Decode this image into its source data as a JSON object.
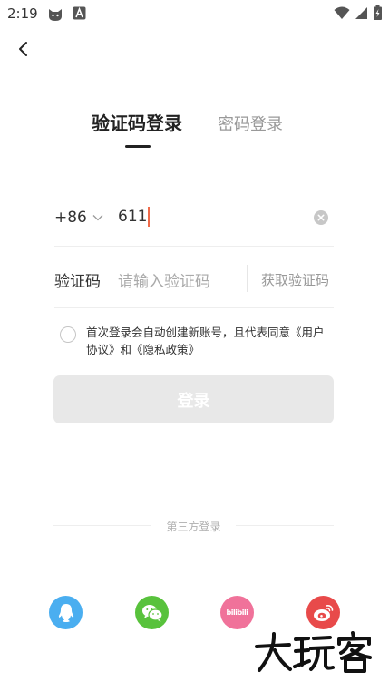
{
  "status_bar": {
    "time": "2:19",
    "icons": [
      "cat-app-icon",
      "a-app-icon",
      "wifi-icon",
      "signal-icon",
      "battery-icon"
    ]
  },
  "nav": {
    "back_icon": "chevron-left-icon"
  },
  "tabs": [
    {
      "label": "验证码登录",
      "active": true
    },
    {
      "label": "密码登录",
      "active": false
    }
  ],
  "phone": {
    "country_code": "+86",
    "value": "611"
  },
  "code": {
    "label": "验证码",
    "placeholder": "请输入验证码",
    "get_code_label": "获取验证码"
  },
  "agreement": {
    "text": "首次登录会自动创建新账号，且代表同意",
    "user_agreement": "《用户协议》",
    "and": "和",
    "privacy_policy": "《隐私政策》",
    "checked": false
  },
  "login": {
    "label": "登录"
  },
  "third_party": {
    "label": "第三方登录",
    "providers": [
      {
        "name": "qq",
        "icon": "qq-icon",
        "color": "#4aaef0"
      },
      {
        "name": "wechat",
        "icon": "wechat-icon",
        "color": "#58c23c"
      },
      {
        "name": "bilibili",
        "icon": "bilibili-icon",
        "color": "#f0729a",
        "logo_text": "bilibili"
      },
      {
        "name": "weibo",
        "icon": "weibo-icon",
        "color": "#e84a4a"
      }
    ]
  },
  "watermark": {
    "text": "大玩客"
  },
  "colors": {
    "caret": "#f06b4a",
    "login_disabled_bg": "#e8e8e8",
    "text_primary": "#222222",
    "text_secondary": "#999999"
  }
}
